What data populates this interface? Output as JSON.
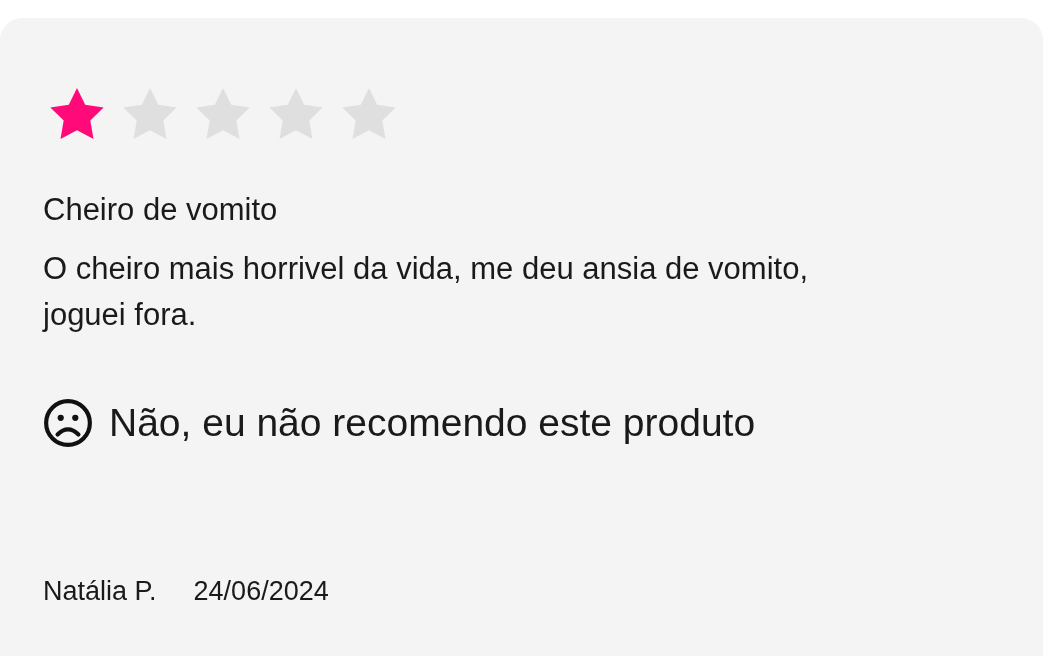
{
  "review": {
    "stars": 1,
    "title": "Cheiro de vomito",
    "body": "O cheiro mais horrivel da vida, me deu ansia de vomito, joguei fora.",
    "recommend": {
      "recommended": false,
      "text": "Não, eu não recomendo este produto"
    },
    "author": "Natália P.",
    "date": "24/06/2024"
  }
}
